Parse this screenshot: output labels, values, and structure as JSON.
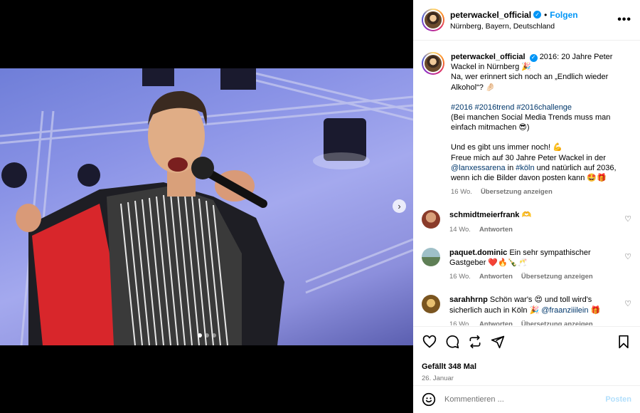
{
  "post": {
    "username": "peterwackel_official",
    "follow_label": "Folgen",
    "separator": "•",
    "location": "Nürnberg, Bayern, Deutschland",
    "more_icon": "more-horizontal-icon"
  },
  "caption": {
    "username": "peterwackel_official",
    "line1": "2016: 20 Jahre Peter Wackel in Nürnberg 🎉",
    "line2": "Na, wer erinnert sich noch an „Endlich wieder Alkohol“? 🤌🏻",
    "hashtags": "#2016 #2016trend #2016challenge",
    "line3": "(Bei manchen Social Media Trends muss man einfach mitmachen 😎)",
    "line4": "Und es gibt uns immer noch! 💪",
    "line5_a": "Freue mich auf 30 Jahre Peter Wackel in der ",
    "mention1": "@lanxessarena",
    "line5_b": " in ",
    "hashtag_koeln": "#köln",
    "line5_c": " und natürlich auf 2036, wenn ich die Bilder davon posten kann 🤩🎁",
    "time": "16 Wo.",
    "translate": "Übersetzung anzeigen"
  },
  "comments": [
    {
      "username": "schmidtmeierfrank",
      "text": " 🫶",
      "time": "14 Wo.",
      "reply": "Antworten",
      "translate": "",
      "avatar_color": "#8a3b2a"
    },
    {
      "username": "paquet.dominic",
      "text": " Ein sehr sympathischer Gastgeber ❤️🔥🍾🥂",
      "time": "16 Wo.",
      "reply": "Antworten",
      "translate": "Übersetzung anzeigen",
      "avatar_color": "#6a8f8a"
    },
    {
      "username": "sarahhrnp",
      "text": " Schön war's 😍 und toll wird's sicherlich auch in Köln 🎉 ",
      "mention": "@fraanziiilein",
      "text_after": " 🎁",
      "time": "16 Wo.",
      "reply": "Antworten",
      "translate": "Übersetzung anzeigen",
      "avatar_color": "#a07a3a"
    }
  ],
  "actions": {
    "likes": "Gefällt 348 Mal",
    "date": "26. Januar",
    "icons": [
      "heart-icon",
      "comment-icon",
      "repost-icon",
      "share-icon",
      "bookmark-icon"
    ]
  },
  "composer": {
    "placeholder": "Kommentieren ...",
    "post_label": "Posten"
  },
  "carousel": {
    "slide_count": 3,
    "active_index": 0
  },
  "colors": {
    "link": "#00376b",
    "accent": "#0095f6",
    "muted": "#737373"
  }
}
